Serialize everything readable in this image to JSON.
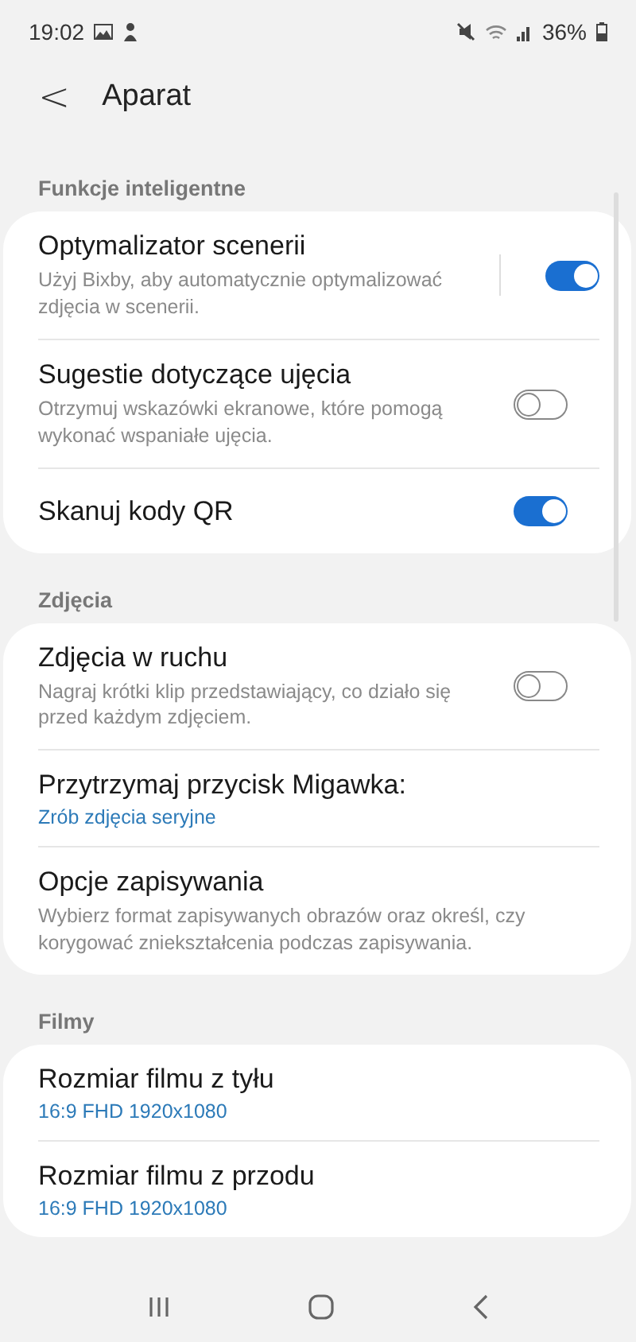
{
  "status_bar": {
    "time": "19:02",
    "battery": "36%"
  },
  "header": {
    "back": "<",
    "title": "Aparat"
  },
  "sections": [
    {
      "title": "Funkcje inteligentne",
      "items": [
        {
          "kind": "switch",
          "title": "Optymalizator scenerii",
          "description": "Użyj Bixby, aby automatycznie optymalizować zdjęcia w scenerii.",
          "on": true,
          "separator": true
        },
        {
          "kind": "switch",
          "title": "Sugestie dotyczące ujęcia",
          "description": "Otrzymuj wskazówki ekranowe, które pomogą wykonać wspaniałe ujęcia.",
          "on": false,
          "separator": false
        },
        {
          "kind": "switch",
          "title": "Skanuj kody QR",
          "on": true,
          "separator": false
        }
      ]
    },
    {
      "title": "Zdjęcia",
      "items": [
        {
          "kind": "switch",
          "title": "Zdjęcia w ruchu",
          "description": "Nagraj krótki klip przedstawiający, co działo się przed każdym zdjęciem.",
          "on": false,
          "separator": false
        },
        {
          "kind": "value",
          "title": "Przytrzymaj przycisk Migawka:",
          "value": "Zrób zdjęcia seryjne"
        },
        {
          "kind": "plain",
          "title": "Opcje zapisywania",
          "description": "Wybierz format zapisywanych obrazów oraz określ, czy korygować zniekształcenia podczas zapisywania."
        }
      ]
    },
    {
      "title": "Filmy",
      "items": [
        {
          "kind": "value",
          "title": "Rozmiar filmu z tyłu",
          "value": "16:9 FHD 1920x1080"
        },
        {
          "kind": "value",
          "title": "Rozmiar filmu z przodu",
          "value": "16:9 FHD 1920x1080"
        }
      ]
    }
  ]
}
